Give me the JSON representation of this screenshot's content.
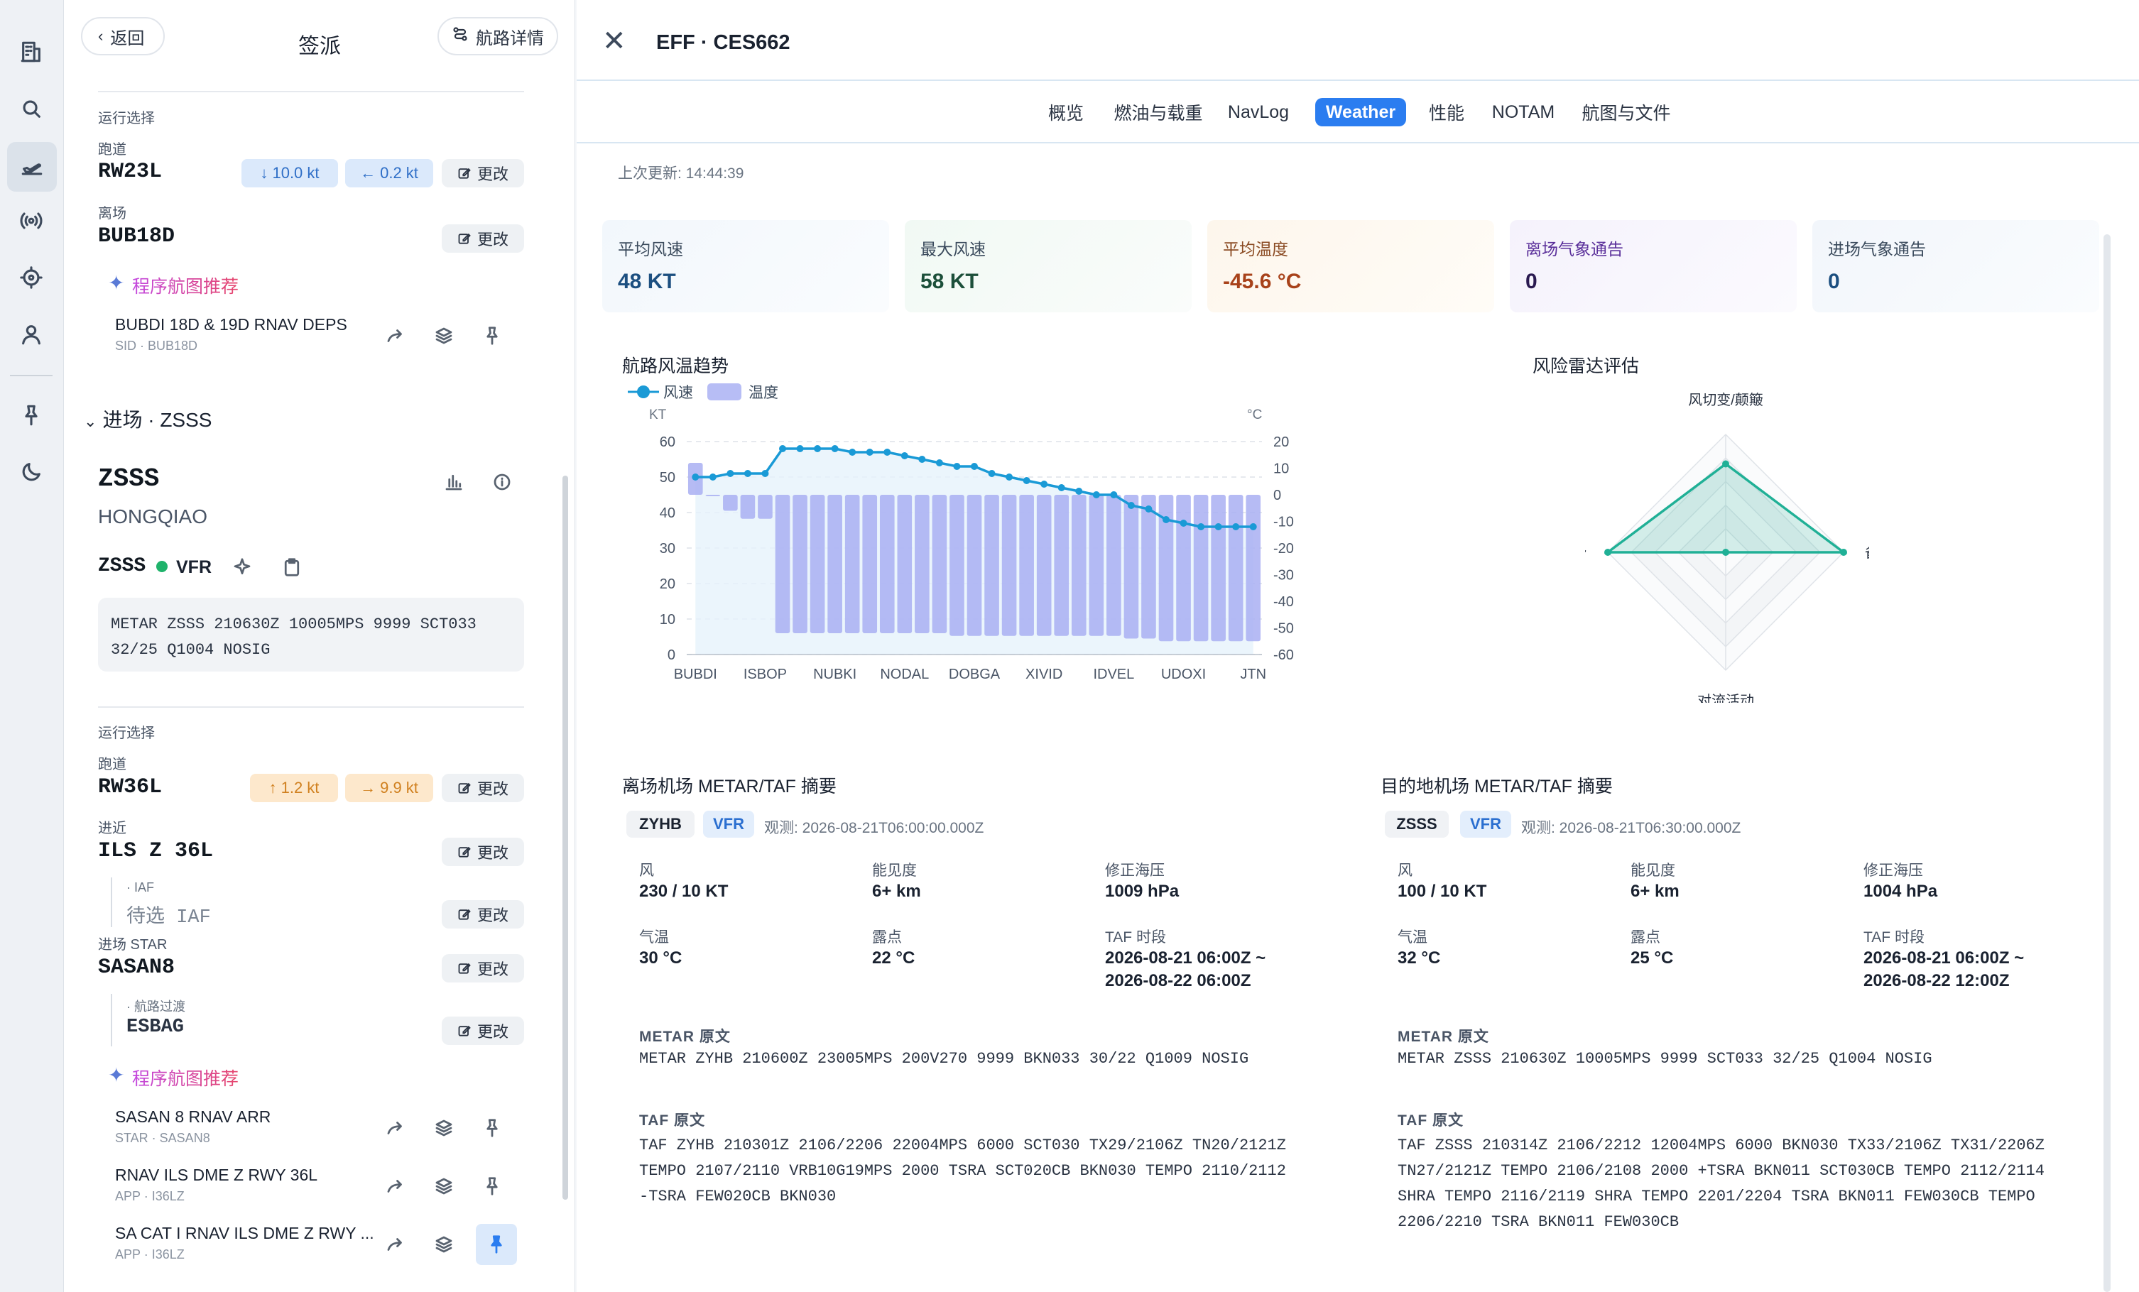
{
  "rail": {
    "icons": [
      "building-icon",
      "search-icon",
      "flight-icon",
      "broadcast-icon",
      "target-icon",
      "user-icon",
      "pin-icon",
      "moon-icon"
    ]
  },
  "dispatch": {
    "back_label": "返回",
    "title": "签派",
    "route_detail_label": "航路详情",
    "dep_ops": {
      "ops_label": "运行选择",
      "runway_label": "跑道",
      "runway": "RW23L",
      "wind_head": "10.0 kt",
      "wind_cross": "0.2 kt",
      "change": "更改",
      "dep_label": "离场",
      "dep": "BUB18D",
      "rec_label": "程序航图推荐",
      "procs": [
        {
          "title": "BUBDI 18D & 19D RNAV DEPS",
          "sub": "SID · BUB18D"
        }
      ]
    },
    "arr_section": "进场 · ZSSS",
    "arr_icao": "ZSSS",
    "arr_name": "HONGQIAO",
    "arr_status_icao": "ZSSS",
    "arr_flight_rule": "VFR",
    "arr_metar": "METAR ZSSS 210630Z 10005MPS 9999 SCT033 32/25 Q1004 NOSIG",
    "arr_ops": {
      "ops_label": "运行选择",
      "runway_label": "跑道",
      "runway": "RW36L",
      "wind_head": "1.2 kt",
      "wind_cross": "9.9 kt",
      "change": "更改",
      "approach_label": "进近",
      "approach": "ILS Z 36L",
      "iaf_label": "· IAF",
      "iaf_value": "待选 IAF",
      "star_label": "进场 STAR",
      "star": "SASAN8",
      "trans_label": "· 航路过渡",
      "trans": "ESBAG",
      "rec_label": "程序航图推荐",
      "procs": [
        {
          "title": "SASAN 8 RNAV ARR",
          "sub": "STAR · SASAN8"
        },
        {
          "title": "RNAV ILS DME Z RWY 36L",
          "sub": "APP · I36LZ"
        },
        {
          "title": "SA CAT I RNAV ILS DME Z RWY ...",
          "sub": "APP · I36LZ"
        }
      ]
    }
  },
  "detail": {
    "title": "EFF · CES662",
    "tabs": [
      "概览",
      "燃油与载重",
      "NavLog",
      "Weather",
      "性能",
      "NOTAM",
      "航图与文件"
    ],
    "active_tab": "Weather",
    "updated": "上次更新: 14:44:39",
    "stats": [
      {
        "label": "平均风速",
        "value": "48 KT",
        "color": "#1c4f80"
      },
      {
        "label": "最大风速",
        "value": "58 KT",
        "color": "#1c4f3a"
      },
      {
        "label": "平均温度",
        "value": "-45.6 °C",
        "color": "#a8421a"
      },
      {
        "label": "离场气象通告",
        "value": "0",
        "color": "#5a2f9a"
      },
      {
        "label": "进场气象通告",
        "value": "0",
        "color": "#1c4f80"
      }
    ],
    "trend_title": "航路风温趋势",
    "radar_title": "风险雷达评估",
    "dep_summary": {
      "title": "离场机场 METAR/TAF 摘要",
      "icao": "ZYHB",
      "rule": "VFR",
      "obs": "观测: 2026-08-21T06:00:00.000Z",
      "wind_k": "风",
      "wind": "230 / 10 KT",
      "vis_k": "能见度",
      "vis": "6+ km",
      "qnh_k": "修正海压",
      "qnh": "1009 hPa",
      "temp_k": "气温",
      "temp": "30 °C",
      "dew_k": "露点",
      "dew": "22 °C",
      "taf_k": "TAF 时段",
      "taf_period1": "2026-08-21 06:00Z ~",
      "taf_period2": "2026-08-22 06:00Z",
      "metar_h": "METAR 原文",
      "metar": "METAR ZYHB 210600Z 23005MPS 200V270 9999 BKN033 30/22 Q1009 NOSIG",
      "taf_h": "TAF 原文",
      "taf_lines": [
        "TAF ZYHB 210301Z 2106/2206 22004MPS 6000 SCT030 TX29/2106Z TN20/2121Z",
        "TEMPO 2107/2110 VRB10G19MPS 2000 TSRA SCT020CB BKN030 TEMPO 2110/2112",
        "-TSRA FEW020CB BKN030"
      ]
    },
    "arr_summary": {
      "title": "目的地机场 METAR/TAF 摘要",
      "icao": "ZSSS",
      "rule": "VFR",
      "obs": "观测: 2026-08-21T06:30:00.000Z",
      "wind_k": "风",
      "wind": "100 / 10 KT",
      "vis_k": "能见度",
      "vis": "6+ km",
      "qnh_k": "修正海压",
      "qnh": "1004 hPa",
      "temp_k": "气温",
      "temp": "32 °C",
      "dew_k": "露点",
      "dew": "25 °C",
      "taf_k": "TAF 时段",
      "taf_period1": "2026-08-21 06:00Z ~",
      "taf_period2": "2026-08-22 12:00Z",
      "metar_h": "METAR 原文",
      "metar": "METAR ZSSS 210630Z 10005MPS 9999 SCT033 32/25 Q1004 NOSIG",
      "taf_h": "TAF 原文",
      "taf_lines": [
        "TAF ZSSS 210314Z 2106/2212 12004MPS 6000 BKN030 TX33/2106Z TX31/2206Z",
        "TN27/2121Z TEMPO 2106/2108 2000 +TSRA BKN011 SCT030CB TEMPO 2112/2114",
        "SHRA TEMPO 2116/2119 SHRA TEMPO 2201/2204 TSRA BKN011 FEW030CB TEMPO",
        "2206/2210 TSRA BKN011 FEW030CB"
      ]
    }
  },
  "chart_data": [
    {
      "type": "line+bar",
      "title": "航路风温趋势",
      "legend": [
        "风速",
        "温度"
      ],
      "y_left_unit": "KT",
      "y_right_unit": "°C",
      "y_left_ticks": [
        "0",
        "10",
        "20",
        "30",
        "40",
        "50",
        "60"
      ],
      "y_right_ticks": [
        "20",
        "10",
        "0",
        "-10",
        "-20",
        "-30",
        "-40",
        "-50",
        "-60"
      ],
      "ylim_left": [
        0,
        60
      ],
      "ylim_right": [
        -60,
        20
      ],
      "x_tick_labels": [
        "BUBDI",
        "ISBOP",
        "NUBKI",
        "NODAL",
        "DOBGA",
        "XIVID",
        "IDVEL",
        "UDOXI",
        "JTN"
      ],
      "series": [
        {
          "name": "风速",
          "values": [
            50,
            50,
            51,
            51,
            51,
            58,
            58,
            58,
            58,
            57,
            57,
            57,
            56,
            55,
            54,
            53,
            53,
            51,
            50,
            49,
            48,
            47,
            46,
            45,
            45,
            42,
            41,
            38,
            37,
            36,
            36,
            36,
            36
          ]
        },
        {
          "name": "温度",
          "values": [
            12,
            0,
            -6,
            -9,
            -9,
            -52,
            -52,
            -52,
            -52,
            -52,
            -52,
            -52,
            -52,
            -52,
            -52,
            -53,
            -53,
            -53,
            -53,
            -53,
            -53,
            -53,
            -53,
            -53,
            -53,
            -54,
            -54,
            -55,
            -55,
            -55,
            -55,
            -55,
            -55
          ]
        }
      ],
      "grid": true
    },
    {
      "type": "radar",
      "title": "风险雷达评估",
      "axes": [
        "风切变/颠簸",
        "备降压力",
        "对流活动",
        "结冰潜势"
      ],
      "values": [
        0.75,
        1.0,
        0.0,
        1.0
      ]
    }
  ]
}
